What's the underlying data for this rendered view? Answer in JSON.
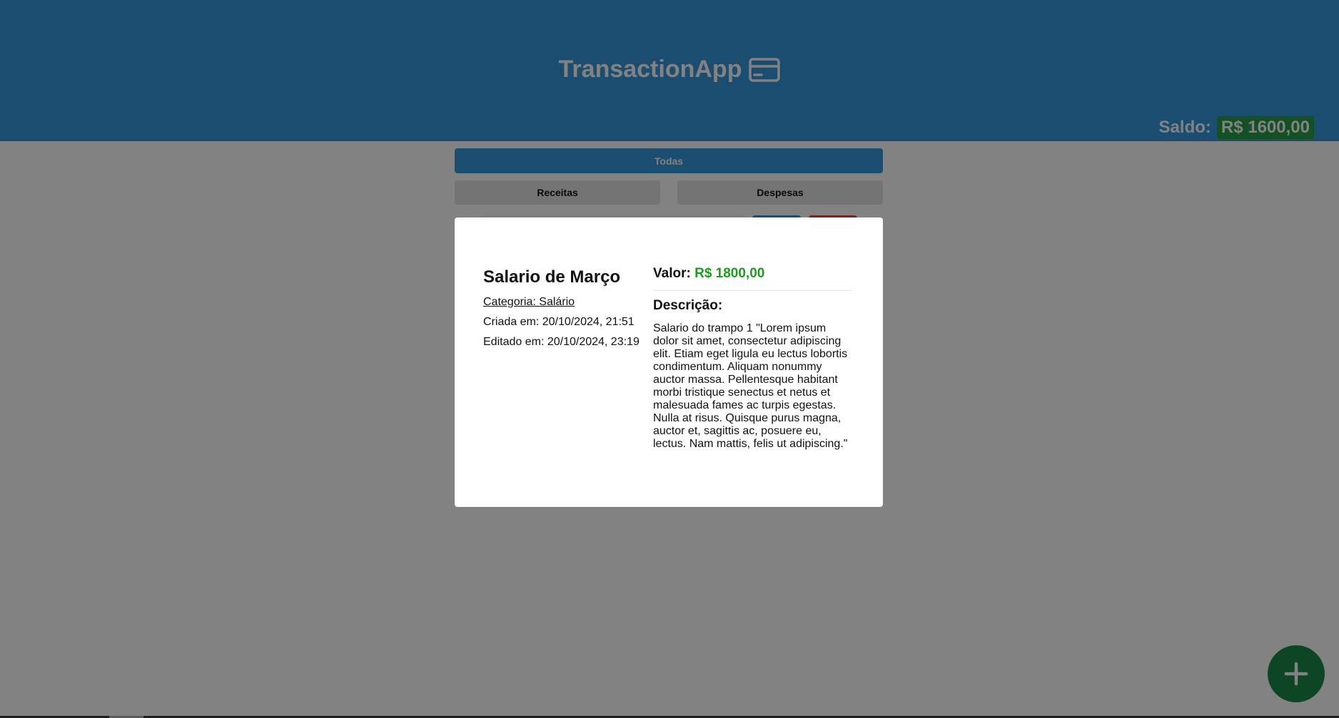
{
  "header": {
    "app_title": "TransactionApp",
    "logo_icon": "credit-card-icon",
    "balance_label": "Saldo:",
    "balance_value": "R$ 1600,00"
  },
  "filters": {
    "all": "Todas",
    "income": "Receitas",
    "expenses": "Despesas"
  },
  "modal": {
    "title": "Salario de Março",
    "category": "Categoria: Salário",
    "created": "Criada em: 20/10/2024, 21:51",
    "edited": "Editado em: 20/10/2024, 23:19",
    "value_label": "Valor:",
    "value_amount": "R$ 1800,00",
    "description_heading": "Descrição:",
    "description": "Salario do trampo 1 \"Lorem ipsum dolor sit amet, consectetur adipiscing elit. Etiam eget ligula eu lectus lobortis condimentum. Aliquam nonummy auctor massa. Pellentesque habitant morbi tristique senectus et netus et malesuada fames ac turpis egestas. Nulla at risus. Quisque purus magna, auctor et, sagittis ac, posuere eu, lectus. Nam mattis, felis ut adipiscing.\""
  },
  "fab": {
    "icon": "plus-icon"
  },
  "colors": {
    "header": "#3498db",
    "balance_badge": "#2a9d4a",
    "amount": "#1f9a1f",
    "fab": "#1a8a4a",
    "delete": "#e74c3c"
  }
}
